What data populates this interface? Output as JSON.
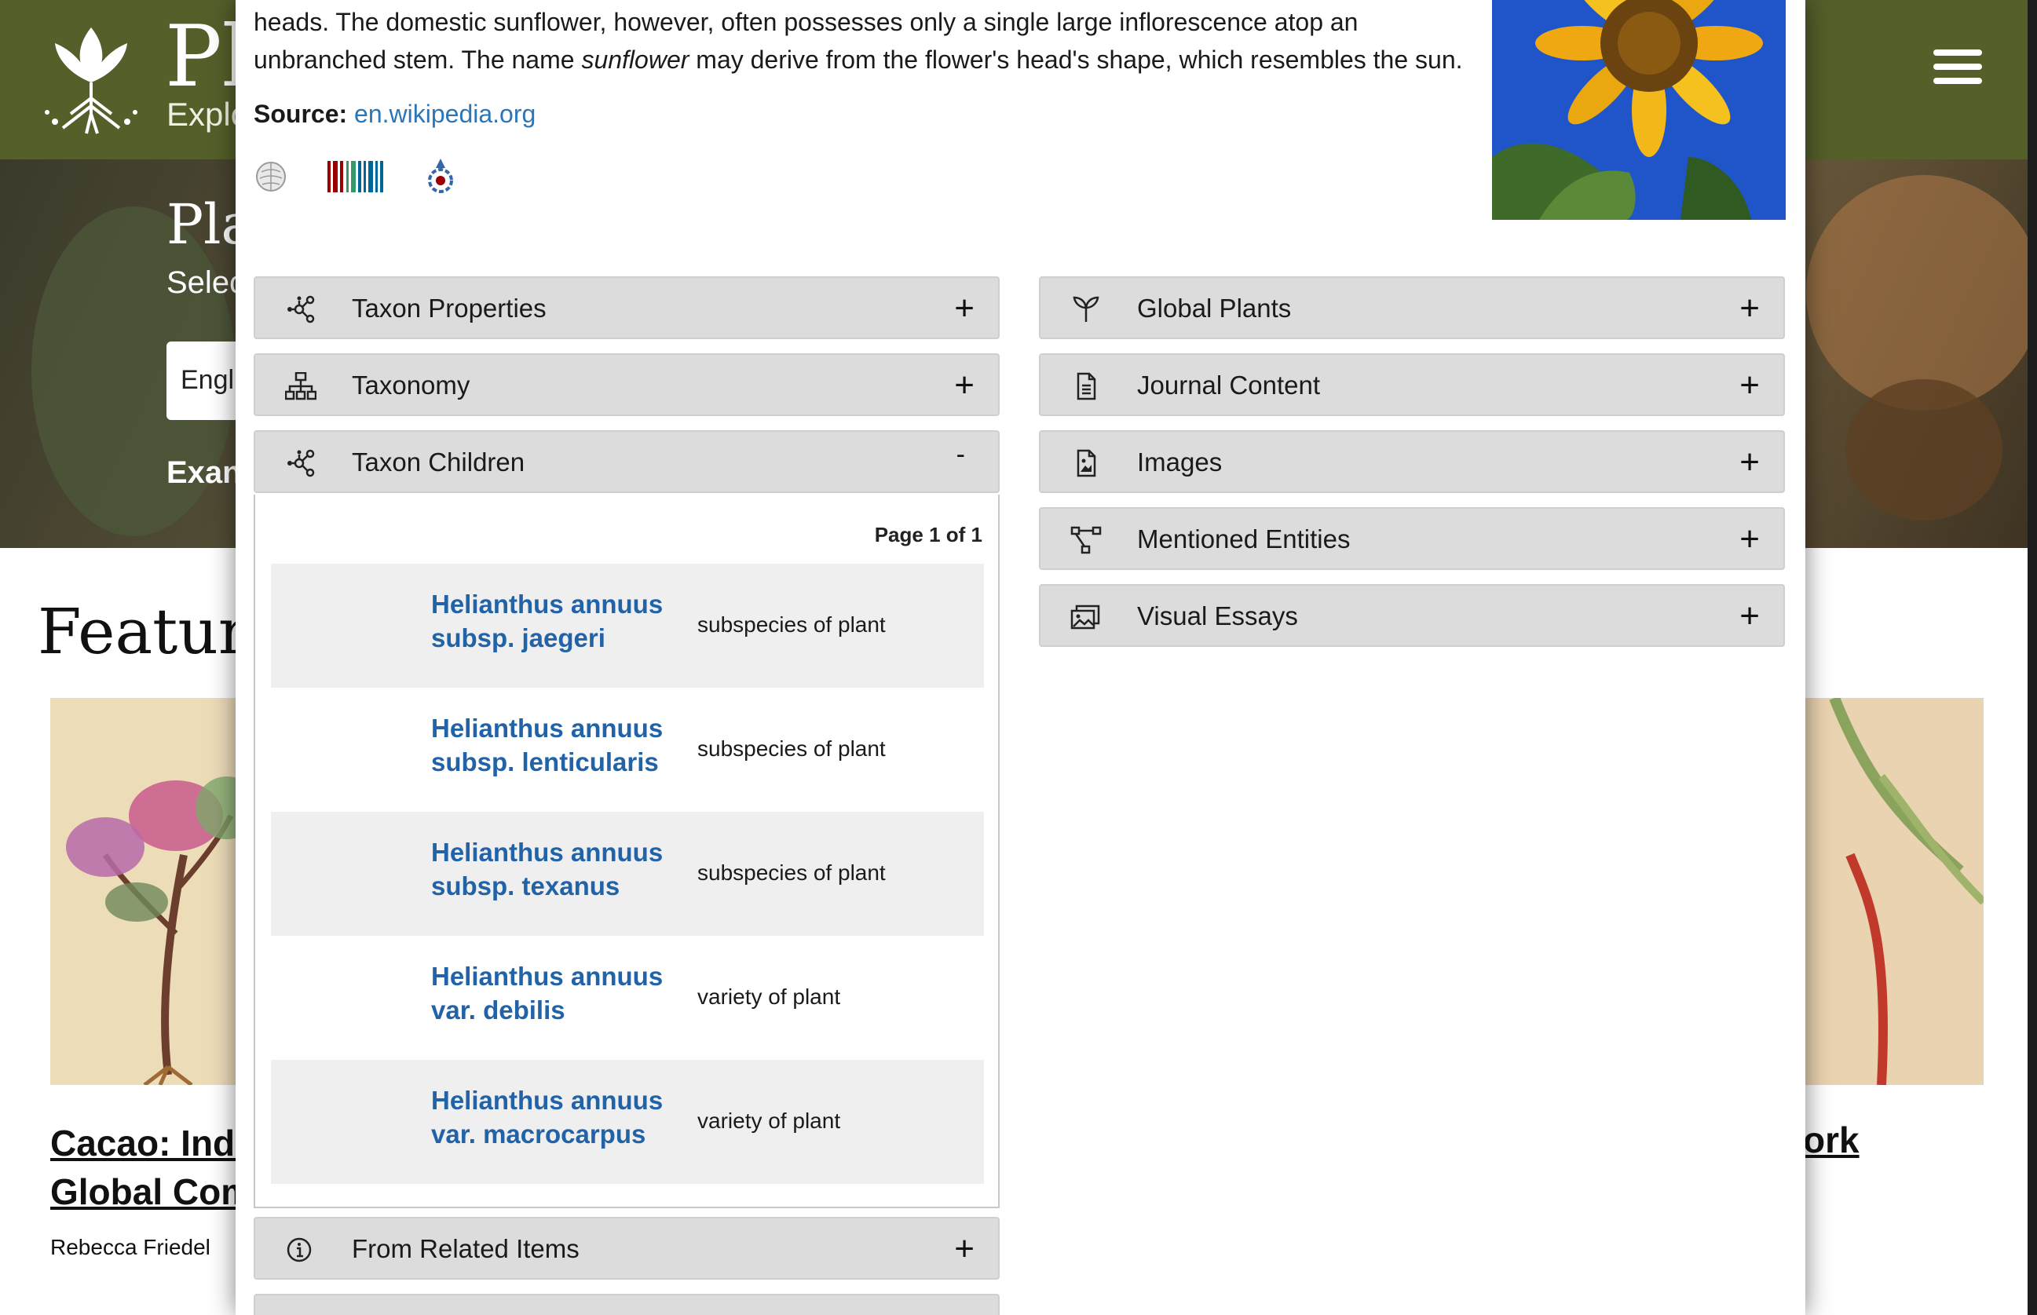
{
  "site": {
    "title": "Pl",
    "subtitle": "Explo"
  },
  "hero": {
    "title": "Pla",
    "subtitle": "Selec",
    "select_value": "Engli",
    "example_label": "Exan"
  },
  "featured": {
    "heading": "Feature",
    "cards": [
      {
        "title_line1": "Cacao: Indi",
        "title_line2": "Global Com",
        "author": "Rebecca Friedel"
      },
      {
        "title_line1": "ork"
      }
    ]
  },
  "modal": {
    "description_line1": "heads. The domestic sunflower, however, often possesses only a single large inflorescence atop an",
    "description_line2_pre": "unbranched stem. The name ",
    "description_line2_em": "sunflower",
    "description_line2_post": " may derive from the flower's head's shape, which resembles the sun.",
    "source_label": "Source:",
    "source_link": "en.wikipedia.org",
    "external_icons": [
      "wikipedia-icon",
      "wikidata-icon",
      "wikimedia-commons-icon"
    ],
    "left_accordions": [
      {
        "label": "Taxon Properties",
        "icon": "taxon-graph-icon",
        "toggle": "+"
      },
      {
        "label": "Taxonomy",
        "icon": "hierarchy-icon",
        "toggle": "+"
      },
      {
        "label": "Taxon Children",
        "icon": "taxon-graph-icon",
        "toggle": "-"
      }
    ],
    "taxon_children": {
      "page_indicator": "Page 1 of 1",
      "rows": [
        {
          "name_line1": "Helianthus annuus",
          "name_line2": "subsp. jaegeri",
          "relation": "subspecies of plant"
        },
        {
          "name_line1": "Helianthus annuus",
          "name_line2": "subsp. lenticularis",
          "relation": "subspecies of plant"
        },
        {
          "name_line1": "Helianthus annuus",
          "name_line2": "subsp. texanus",
          "relation": "subspecies of plant"
        },
        {
          "name_line1": "Helianthus annuus",
          "name_line2": "var. debilis",
          "relation": "variety of plant"
        },
        {
          "name_line1": "Helianthus annuus",
          "name_line2": "var. macrocarpus",
          "relation": "variety of plant"
        }
      ]
    },
    "from_related": {
      "label": "From Related Items",
      "icon": "info-icon",
      "toggle": "+"
    },
    "right_accordions": [
      {
        "label": "Global Plants",
        "icon": "sprout-icon",
        "toggle": "+"
      },
      {
        "label": "Journal Content",
        "icon": "document-icon",
        "toggle": "+"
      },
      {
        "label": "Images",
        "icon": "image-file-icon",
        "toggle": "+"
      },
      {
        "label": "Mentioned Entities",
        "icon": "entity-graph-icon",
        "toggle": "+"
      },
      {
        "label": "Visual Essays",
        "icon": "photo-stack-icon",
        "toggle": "+"
      }
    ]
  },
  "colors": {
    "header_green": "#545f2a",
    "link_blue": "#2c76b8",
    "taxon_link_blue": "#2263a8",
    "accordion_bg": "#dcdcdc"
  }
}
